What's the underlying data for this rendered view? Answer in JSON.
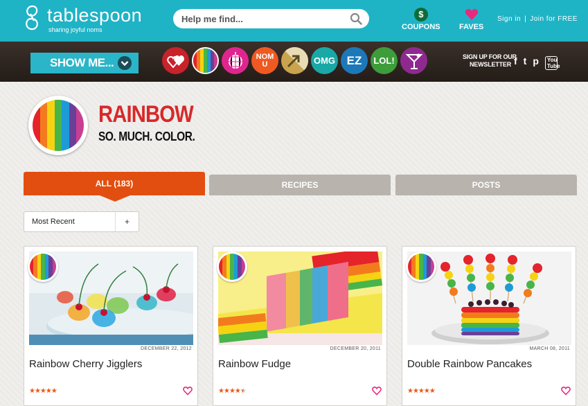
{
  "brand": {
    "name": "tablespoon",
    "tagline": "sharing joyful noms"
  },
  "search": {
    "placeholder": "Help me find..."
  },
  "header": {
    "coupons": "COUPONS",
    "coupons_symbol": "$",
    "faves": "FAVES",
    "sign_in": "Sign in",
    "separator": "|",
    "join": "Join for FREE"
  },
  "nav": {
    "show_me": "SHOW ME...",
    "categories": [
      {
        "name": "love",
        "label": "",
        "color": "#c8222a"
      },
      {
        "name": "rainbow",
        "label": "",
        "color": "#ffffff"
      },
      {
        "name": "party",
        "label": "",
        "color": "#e0258f"
      },
      {
        "name": "nom",
        "label": "NOM U",
        "color": "#ef5a23"
      },
      {
        "name": "hack",
        "label": "",
        "color": "#c9a34e"
      },
      {
        "name": "omg",
        "label": "OMG",
        "color": "#1aa8a6"
      },
      {
        "name": "ez",
        "label": "EZ",
        "color": "#1d78b8"
      },
      {
        "name": "lol",
        "label": "LOL!",
        "color": "#3e9d3a"
      },
      {
        "name": "cocktail",
        "label": "",
        "color": "#8e2a8f"
      }
    ],
    "newsletter_line1": "SIGN UP FOR OUR",
    "newsletter_line2": "NEWSLETTER",
    "social": {
      "facebook": "f",
      "twitter": "t",
      "pinterest": "p",
      "youtube": "You Tube"
    }
  },
  "hero": {
    "title": "RAINBOW",
    "subtitle": "SO. MUCH. COLOR.",
    "stripe_colors": [
      "#e4232b",
      "#f27c1d",
      "#f6d312",
      "#47b549",
      "#1e9bd7",
      "#6a3f98",
      "#c73e93"
    ]
  },
  "tabs": {
    "all": "ALL (183)",
    "recipes": "RECIPES",
    "posts": "POSTS"
  },
  "sort": {
    "selected": "Most Recent",
    "toggle": "+"
  },
  "cards": [
    {
      "title": "Rainbow Cherry Jigglers",
      "date": "DECEMBER 22, 2012",
      "rating": 5,
      "stars": "★★★★★"
    },
    {
      "title": "Rainbow Fudge",
      "date": "DECEMBER 20, 2011",
      "rating": 4.5,
      "stars": "★★★★★"
    },
    {
      "title": "Double Rainbow Pancakes",
      "date": "MARCH 08, 2011",
      "rating": 5,
      "stars": "★★★★★"
    }
  ],
  "colors": {
    "teal": "#1fb3c6",
    "orange": "#e24e0f",
    "red": "#d7292b",
    "tab_gray": "#b8b3ac"
  }
}
